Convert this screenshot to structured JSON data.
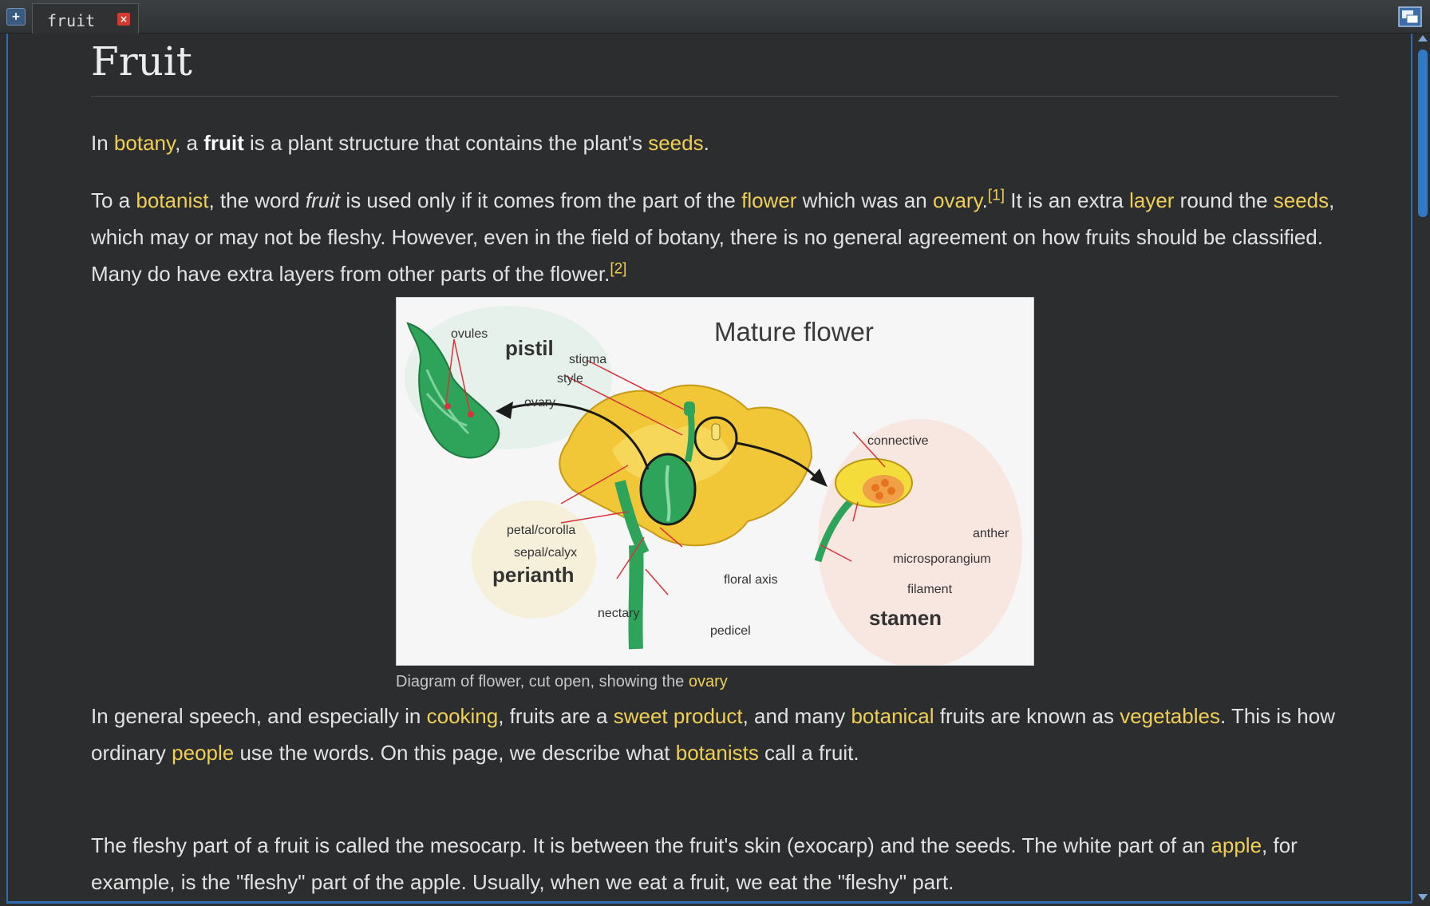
{
  "tabs": {
    "active_label": "fruit"
  },
  "article": {
    "title": "Fruit",
    "p1": {
      "t1": "In ",
      "botany": "botany",
      "t2": ", a ",
      "fruit": "fruit",
      "t3": " is a plant structure that contains the plant's ",
      "seeds": "seeds",
      "t4": "."
    },
    "p2": {
      "t1": "To a ",
      "botanist": "botanist",
      "t2": ", the word ",
      "fruit_italic": "fruit",
      "t3": " is used only if it comes from the part of the ",
      "flower": "flower",
      "t4": " which was an ",
      "ovary": "ovary",
      "t5": ".",
      "ref1": "[1]",
      "t6": " It is an extra ",
      "layer": "layer",
      "t7": " round the ",
      "seeds": "seeds",
      "t8": ", which may or may not be fleshy. However, even in the field of botany, there is no general agreement on how fruits should be classified. Many do have extra layers from other parts of the flower.",
      "ref2": "[2]"
    },
    "figure": {
      "title": "Mature flower",
      "labels": {
        "ovules": "ovules",
        "pistil": "pistil",
        "stigma": "stigma",
        "style": "style",
        "ovary": "ovary",
        "connective": "connective",
        "anther": "anther",
        "microsporangium": "microsporangium",
        "filament": "filament",
        "stamen": "stamen",
        "petal": "petal/corolla",
        "sepal": "sepal/calyx",
        "perianth": "perianth",
        "nectary": "nectary",
        "floral_axis": "floral axis",
        "pedicel": "pedicel"
      },
      "caption_text": "Diagram of flower, cut open, showing the ",
      "caption_link": "ovary"
    },
    "p3": {
      "t1": "In general speech, and especially in ",
      "cooking": "cooking",
      "t2": ", fruits are a ",
      "sweet": "sweet product",
      "t3": ", and many ",
      "botanical": "botanical",
      "t4": " fruits are known as ",
      "vegetables": "vegetables",
      "t5": ". This is how ordinary ",
      "people": "people",
      "t6": " use the words. On this page, we describe what ",
      "botanists": "botanists",
      "t7": " call a fruit."
    },
    "p4": {
      "t1": "The fleshy part of a fruit is called the mesocarp. It is between the fruit's skin (exocarp) and the seeds. The white part of an ",
      "apple": "apple",
      "t2": ", for example, is the \"fleshy\" part of the apple. Usually, when we eat a fruit, we eat the \"fleshy\" part."
    }
  }
}
